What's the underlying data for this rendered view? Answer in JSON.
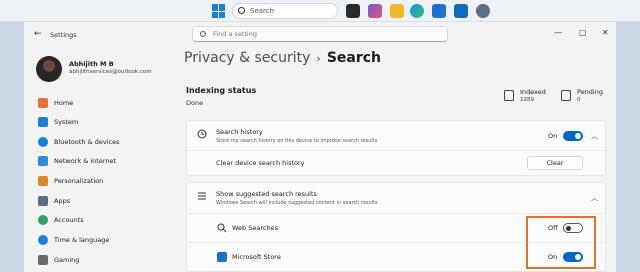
{
  "taskbar": {
    "search_placeholder": "Search",
    "apps": [
      {
        "icon": "terminal-icon",
        "color": "#2b2b2b"
      },
      {
        "icon": "copilot-icon",
        "color": "#7a58c8"
      },
      {
        "icon": "file-explorer-icon",
        "color": "#f2b82a"
      },
      {
        "icon": "edge-icon",
        "color": "#1b8fd6"
      },
      {
        "icon": "store-icon",
        "color": "#1d6fd4"
      },
      {
        "icon": "outlook-icon",
        "color": "#0f6cbd"
      },
      {
        "icon": "settings-icon",
        "color": "#5a6f88"
      }
    ]
  },
  "window": {
    "title": "Settings",
    "controls": {
      "minimize": "—",
      "maximize": "▢",
      "close": "✕"
    }
  },
  "search": {
    "placeholder": "Find a setting"
  },
  "profile": {
    "name": "Abhijith M B",
    "email": "abhijithservices@outlook.com"
  },
  "sidebar": {
    "items": [
      {
        "label": "Home",
        "icon": "home-icon",
        "color": "#e0733a"
      },
      {
        "label": "System",
        "icon": "system-icon",
        "color": "#1a7fd8"
      },
      {
        "label": "Bluetooth & devices",
        "icon": "bluetooth-icon",
        "color": "#1a7fd8"
      },
      {
        "label": "Network & internet",
        "icon": "wifi-icon",
        "color": "#2a8be0"
      },
      {
        "label": "Personalization",
        "icon": "brush-icon",
        "color": "#d9892a"
      },
      {
        "label": "Apps",
        "icon": "apps-icon",
        "color": "#5b6d82"
      },
      {
        "label": "Accounts",
        "icon": "accounts-icon",
        "color": "#2aa06a"
      },
      {
        "label": "Time & language",
        "icon": "globe-clock-icon",
        "color": "#1a7fd8"
      },
      {
        "label": "Gaming",
        "icon": "gaming-icon",
        "color": "#6b6b6b"
      }
    ]
  },
  "breadcrumb": {
    "parent": "Privacy & security",
    "separator": "›",
    "current": "Search"
  },
  "indexing": {
    "title": "Indexing status",
    "status": "Done",
    "indexed_label": "Indexed",
    "indexed_value": "1289",
    "pending_label": "Pending",
    "pending_value": "0"
  },
  "search_history": {
    "title": "Search history",
    "description": "Store my search history on this device to improve search results",
    "state": "On",
    "clear_label": "Clear device search history",
    "clear_button": "Clear"
  },
  "suggested": {
    "title": "Show suggested search results",
    "description": "Windows Search will include suggested content in search results",
    "items": [
      {
        "label": "Web Searches",
        "state": "Off",
        "icon": "search-icon"
      },
      {
        "label": "Microsoft Store",
        "state": "On",
        "icon": "store-icon"
      }
    ]
  },
  "colors": {
    "accent": "#0067c0",
    "highlight": "#e2712f"
  }
}
